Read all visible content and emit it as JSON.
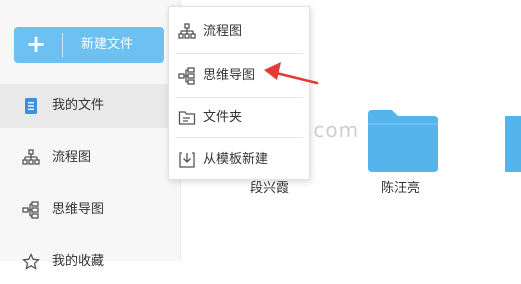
{
  "sidebar": {
    "new_button": {
      "icon": "plus-icon",
      "label": "新建文件"
    },
    "items": [
      {
        "label": "我的文件",
        "icon": "document-icon",
        "active": true
      },
      {
        "label": "流程图",
        "icon": "flowchart-icon"
      },
      {
        "label": "思维导图",
        "icon": "mindmap-icon"
      },
      {
        "label": "我的收藏",
        "icon": "star-icon"
      }
    ]
  },
  "context_menu": {
    "items": [
      {
        "label": "流程图",
        "icon": "flowchart-icon"
      },
      {
        "label": "思维导图",
        "icon": "mindmap-icon"
      },
      {
        "label": "文件夹",
        "icon": "folder-outline-icon"
      },
      {
        "label": "从模板新建",
        "icon": "template-import-icon"
      }
    ]
  },
  "main": {
    "folders": [
      {
        "name": "段兴霞"
      },
      {
        "name": "陈汪亮"
      }
    ]
  },
  "watermark": "tuhuaba.com",
  "colors": {
    "accent": "#6cc0f2",
    "folder": "#56b4ec",
    "arrow": "#e53935"
  }
}
